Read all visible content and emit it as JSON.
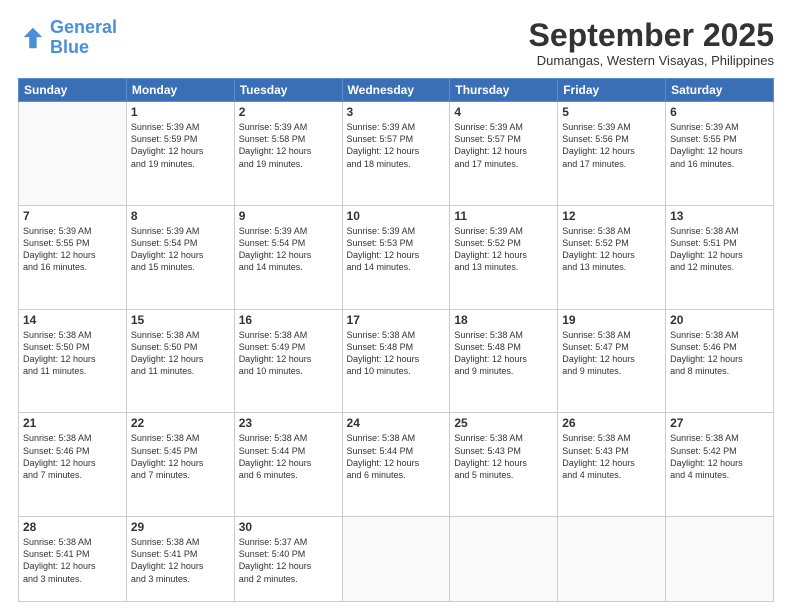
{
  "logo": {
    "line1": "General",
    "line2": "Blue"
  },
  "title": "September 2025",
  "subtitle": "Dumangas, Western Visayas, Philippines",
  "days_of_week": [
    "Sunday",
    "Monday",
    "Tuesday",
    "Wednesday",
    "Thursday",
    "Friday",
    "Saturday"
  ],
  "weeks": [
    [
      {
        "day": "",
        "info": ""
      },
      {
        "day": "1",
        "info": "Sunrise: 5:39 AM\nSunset: 5:59 PM\nDaylight: 12 hours\nand 19 minutes."
      },
      {
        "day": "2",
        "info": "Sunrise: 5:39 AM\nSunset: 5:58 PM\nDaylight: 12 hours\nand 19 minutes."
      },
      {
        "day": "3",
        "info": "Sunrise: 5:39 AM\nSunset: 5:57 PM\nDaylight: 12 hours\nand 18 minutes."
      },
      {
        "day": "4",
        "info": "Sunrise: 5:39 AM\nSunset: 5:57 PM\nDaylight: 12 hours\nand 17 minutes."
      },
      {
        "day": "5",
        "info": "Sunrise: 5:39 AM\nSunset: 5:56 PM\nDaylight: 12 hours\nand 17 minutes."
      },
      {
        "day": "6",
        "info": "Sunrise: 5:39 AM\nSunset: 5:55 PM\nDaylight: 12 hours\nand 16 minutes."
      }
    ],
    [
      {
        "day": "7",
        "info": "Sunrise: 5:39 AM\nSunset: 5:55 PM\nDaylight: 12 hours\nand 16 minutes."
      },
      {
        "day": "8",
        "info": "Sunrise: 5:39 AM\nSunset: 5:54 PM\nDaylight: 12 hours\nand 15 minutes."
      },
      {
        "day": "9",
        "info": "Sunrise: 5:39 AM\nSunset: 5:54 PM\nDaylight: 12 hours\nand 14 minutes."
      },
      {
        "day": "10",
        "info": "Sunrise: 5:39 AM\nSunset: 5:53 PM\nDaylight: 12 hours\nand 14 minutes."
      },
      {
        "day": "11",
        "info": "Sunrise: 5:39 AM\nSunset: 5:52 PM\nDaylight: 12 hours\nand 13 minutes."
      },
      {
        "day": "12",
        "info": "Sunrise: 5:38 AM\nSunset: 5:52 PM\nDaylight: 12 hours\nand 13 minutes."
      },
      {
        "day": "13",
        "info": "Sunrise: 5:38 AM\nSunset: 5:51 PM\nDaylight: 12 hours\nand 12 minutes."
      }
    ],
    [
      {
        "day": "14",
        "info": "Sunrise: 5:38 AM\nSunset: 5:50 PM\nDaylight: 12 hours\nand 11 minutes."
      },
      {
        "day": "15",
        "info": "Sunrise: 5:38 AM\nSunset: 5:50 PM\nDaylight: 12 hours\nand 11 minutes."
      },
      {
        "day": "16",
        "info": "Sunrise: 5:38 AM\nSunset: 5:49 PM\nDaylight: 12 hours\nand 10 minutes."
      },
      {
        "day": "17",
        "info": "Sunrise: 5:38 AM\nSunset: 5:48 PM\nDaylight: 12 hours\nand 10 minutes."
      },
      {
        "day": "18",
        "info": "Sunrise: 5:38 AM\nSunset: 5:48 PM\nDaylight: 12 hours\nand 9 minutes."
      },
      {
        "day": "19",
        "info": "Sunrise: 5:38 AM\nSunset: 5:47 PM\nDaylight: 12 hours\nand 9 minutes."
      },
      {
        "day": "20",
        "info": "Sunrise: 5:38 AM\nSunset: 5:46 PM\nDaylight: 12 hours\nand 8 minutes."
      }
    ],
    [
      {
        "day": "21",
        "info": "Sunrise: 5:38 AM\nSunset: 5:46 PM\nDaylight: 12 hours\nand 7 minutes."
      },
      {
        "day": "22",
        "info": "Sunrise: 5:38 AM\nSunset: 5:45 PM\nDaylight: 12 hours\nand 7 minutes."
      },
      {
        "day": "23",
        "info": "Sunrise: 5:38 AM\nSunset: 5:44 PM\nDaylight: 12 hours\nand 6 minutes."
      },
      {
        "day": "24",
        "info": "Sunrise: 5:38 AM\nSunset: 5:44 PM\nDaylight: 12 hours\nand 6 minutes."
      },
      {
        "day": "25",
        "info": "Sunrise: 5:38 AM\nSunset: 5:43 PM\nDaylight: 12 hours\nand 5 minutes."
      },
      {
        "day": "26",
        "info": "Sunrise: 5:38 AM\nSunset: 5:43 PM\nDaylight: 12 hours\nand 4 minutes."
      },
      {
        "day": "27",
        "info": "Sunrise: 5:38 AM\nSunset: 5:42 PM\nDaylight: 12 hours\nand 4 minutes."
      }
    ],
    [
      {
        "day": "28",
        "info": "Sunrise: 5:38 AM\nSunset: 5:41 PM\nDaylight: 12 hours\nand 3 minutes."
      },
      {
        "day": "29",
        "info": "Sunrise: 5:38 AM\nSunset: 5:41 PM\nDaylight: 12 hours\nand 3 minutes."
      },
      {
        "day": "30",
        "info": "Sunrise: 5:37 AM\nSunset: 5:40 PM\nDaylight: 12 hours\nand 2 minutes."
      },
      {
        "day": "",
        "info": ""
      },
      {
        "day": "",
        "info": ""
      },
      {
        "day": "",
        "info": ""
      },
      {
        "day": "",
        "info": ""
      }
    ]
  ]
}
